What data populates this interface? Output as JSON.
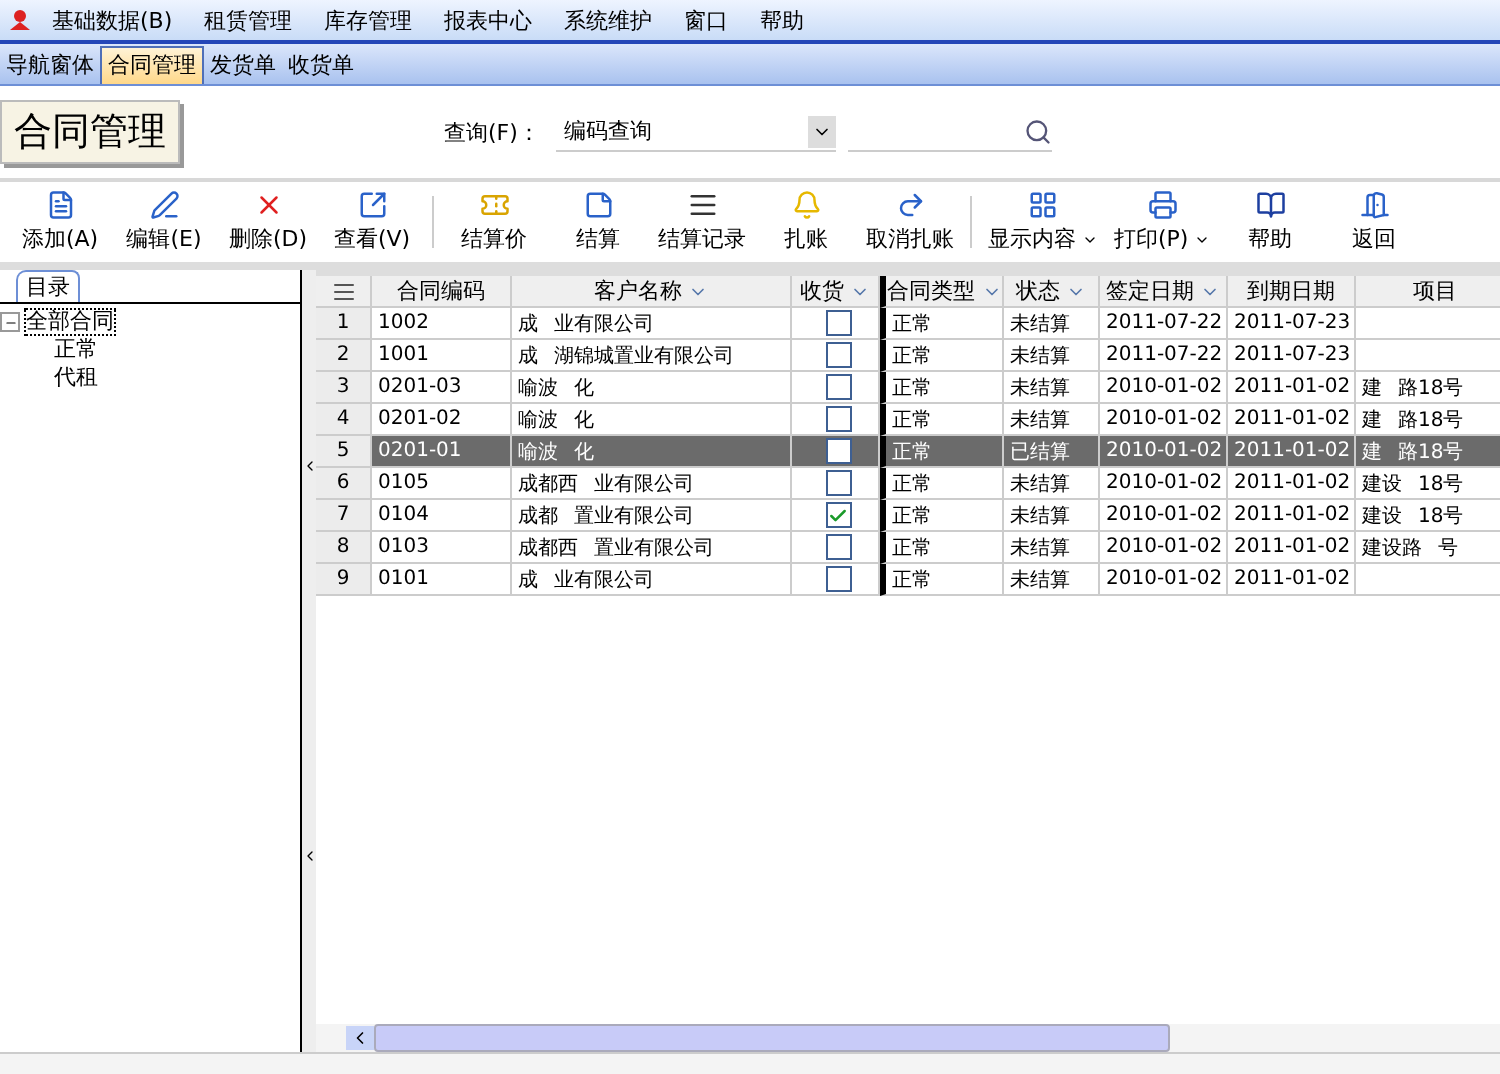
{
  "menu": [
    {
      "label": "基础数据(B)"
    },
    {
      "label": "租赁管理"
    },
    {
      "label": "库存管理"
    },
    {
      "label": "报表中心"
    },
    {
      "label": "系统维护"
    },
    {
      "label": "窗口"
    },
    {
      "label": "帮助"
    }
  ],
  "window_tabs": [
    {
      "label": "导航窗体",
      "selected": false
    },
    {
      "label": "合同管理",
      "selected": true
    },
    {
      "label": "发货单",
      "selected": false
    },
    {
      "label": "收货单",
      "selected": false
    }
  ],
  "page_title": "合同管理",
  "query": {
    "label": "查询(F)：",
    "mode": "编码查询"
  },
  "toolbar": [
    {
      "label": "添加(A)",
      "dropdown": false
    },
    {
      "label": "编辑(E)",
      "dropdown": false
    },
    {
      "label": "删除(D)",
      "dropdown": false
    },
    {
      "label": "查看(V)",
      "dropdown": false
    },
    {
      "label": "结算价",
      "dropdown": false
    },
    {
      "label": "结算",
      "dropdown": false
    },
    {
      "label": "结算记录",
      "dropdown": false
    },
    {
      "label": "扎账",
      "dropdown": false
    },
    {
      "label": "取消扎账",
      "dropdown": false
    },
    {
      "label": "显示内容",
      "dropdown": true
    },
    {
      "label": "打印(P)",
      "dropdown": true
    },
    {
      "label": "帮助",
      "dropdown": false
    },
    {
      "label": "返回",
      "dropdown": false
    }
  ],
  "sidebar": {
    "tab": "目录",
    "tree": [
      {
        "label": "全部合同",
        "expanded": true,
        "selected": true,
        "children": [
          {
            "label": "正常",
            "selected": false
          },
          {
            "label": "代租",
            "selected": false
          }
        ]
      }
    ]
  },
  "table": {
    "columns": [
      {
        "label": "合同编码",
        "filter": false
      },
      {
        "label": "客户名称",
        "filter": true
      },
      {
        "label": "收货",
        "filter": true
      },
      {
        "label": "合同类型",
        "filter": true
      },
      {
        "label": "状态",
        "filter": true
      },
      {
        "label": "签定日期",
        "filter": true
      },
      {
        "label": "到期日期",
        "filter": false
      },
      {
        "label": "项目",
        "filter": false
      }
    ],
    "rows": [
      {
        "num": "1",
        "code": "1002",
        "customer": [
          "成",
          "业有限公司"
        ],
        "received": false,
        "type": "正常",
        "status": "未结算",
        "signed": "2011-07-22",
        "due": "2011-07-23",
        "project": [],
        "selected": false
      },
      {
        "num": "2",
        "code": "1001",
        "customer": [
          "成",
          "湖锦城置业有限公司"
        ],
        "received": false,
        "type": "正常",
        "status": "未结算",
        "signed": "2011-07-22",
        "due": "2011-07-23",
        "project": [],
        "selected": false
      },
      {
        "num": "3",
        "code": "0201-03",
        "customer": [
          "喻波",
          "化"
        ],
        "received": false,
        "type": "正常",
        "status": "未结算",
        "signed": "2010-01-02",
        "due": "2011-01-02",
        "project": [
          "建",
          "路18号"
        ],
        "selected": false
      },
      {
        "num": "4",
        "code": "0201-02",
        "customer": [
          "喻波",
          "化"
        ],
        "received": false,
        "type": "正常",
        "status": "未结算",
        "signed": "2010-01-02",
        "due": "2011-01-02",
        "project": [
          "建",
          "路18号"
        ],
        "selected": false
      },
      {
        "num": "5",
        "code": "0201-01",
        "customer": [
          "喻波",
          "化"
        ],
        "received": false,
        "type": "正常",
        "status": "已结算",
        "signed": "2010-01-02",
        "due": "2011-01-02",
        "project": [
          "建",
          "路18号"
        ],
        "selected": true
      },
      {
        "num": "6",
        "code": "0105",
        "customer": [
          "成都西",
          "业有限公司"
        ],
        "received": false,
        "type": "正常",
        "status": "未结算",
        "signed": "2010-01-02",
        "due": "2011-01-02",
        "project": [
          "建设",
          "18号"
        ],
        "selected": false
      },
      {
        "num": "7",
        "code": "0104",
        "customer": [
          "成都",
          "置业有限公司"
        ],
        "received": true,
        "type": "正常",
        "status": "未结算",
        "signed": "2010-01-02",
        "due": "2011-01-02",
        "project": [
          "建设",
          "18号"
        ],
        "selected": false
      },
      {
        "num": "8",
        "code": "0103",
        "customer": [
          "成都西",
          "置业有限公司"
        ],
        "received": false,
        "type": "正常",
        "status": "未结算",
        "signed": "2010-01-02",
        "due": "2011-01-02",
        "project": [
          "建设路",
          "号"
        ],
        "selected": false
      },
      {
        "num": "9",
        "code": "0101",
        "customer": [
          "成",
          "业有限公司"
        ],
        "received": false,
        "type": "正常",
        "status": "未结算",
        "signed": "2010-01-02",
        "due": "2011-01-02",
        "project": [],
        "selected": false
      }
    ]
  }
}
